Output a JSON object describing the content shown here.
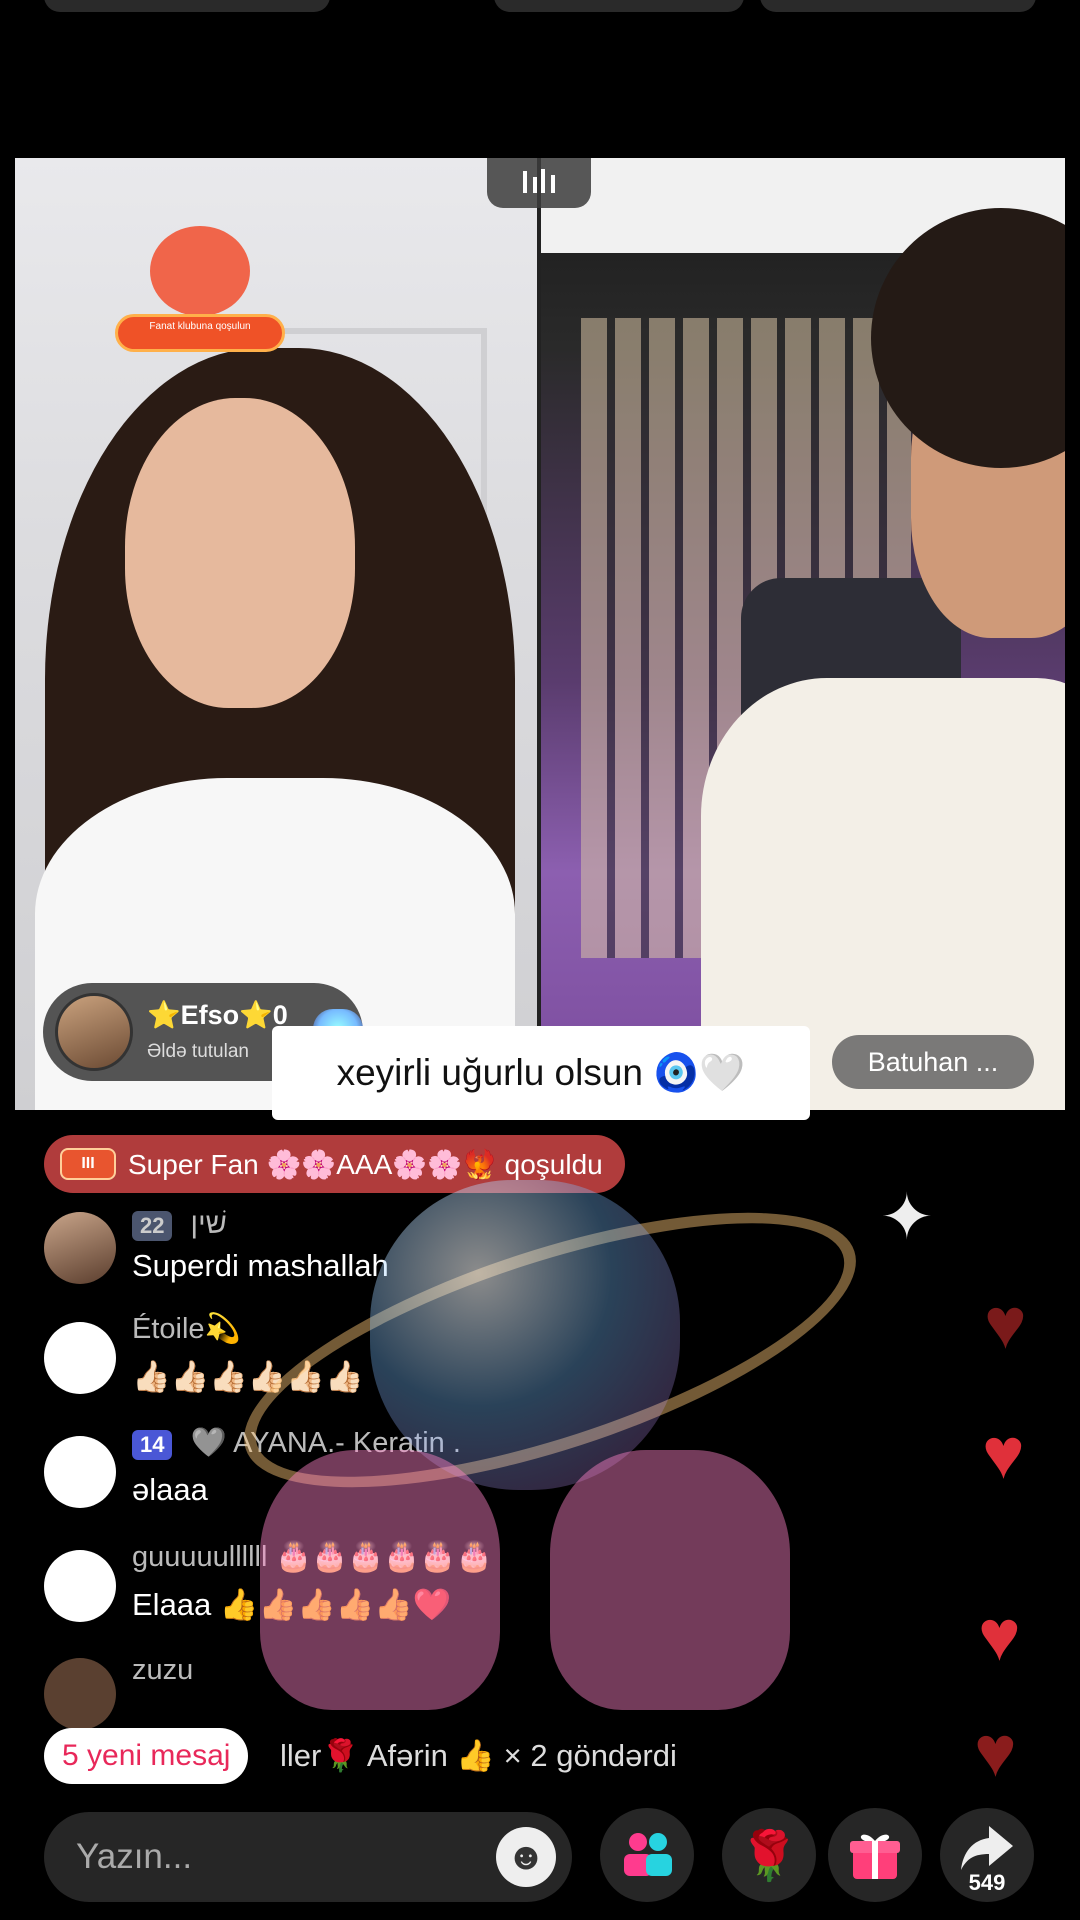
{
  "top_bar": {},
  "video": {
    "split_handle_icon": "split-view-handle-icon",
    "fan_club_label": "Fanat klubuna qoşulun",
    "host": {
      "name": "⭐Efso⭐0",
      "subtitle": "Əldə tutulan"
    },
    "guest": {
      "name": "Batuhan ..."
    },
    "caption": "xeyirli uğurlu olsun 🧿🤍"
  },
  "feed": {
    "joined_banner": {
      "badge": "III",
      "text": "Super Fan 🌸🌸AAA🌸🌸🐦‍🔥 qoşuldu"
    },
    "comments": [
      {
        "level": "22",
        "name": "שׁין",
        "text": "Superdi mashallah"
      },
      {
        "level": "",
        "name": "Étoile💫",
        "text": "👍🏻👍🏻👍🏻👍🏻👍🏻👍🏻"
      },
      {
        "level": "14",
        "name": "🩶 AYANA.- Keratin .",
        "text": "əlaaa"
      },
      {
        "level": "",
        "name": "guuuuullllll 🎂🎂🎂🎂🎂🎂",
        "text": "Elaaa 👍👍👍👍👍❤️"
      },
      {
        "level": "",
        "name": "zuzu",
        "text": ""
      }
    ],
    "gift_line": "ller🌹 Afərin 👍 × 2 göndərdi",
    "new_messages": "5 yeni mesaj"
  },
  "bottom_bar": {
    "input_placeholder": "Yazın...",
    "share_count": "549",
    "icons": {
      "emoji": "smiley-face-icon",
      "guests": "multi-guest-icon",
      "rose": "rose-gift-icon",
      "gift": "gift-box-icon",
      "share": "share-arrow-icon"
    }
  },
  "colors": {
    "banner": "#b03c3c",
    "new_message_text": "#e8285a",
    "heart": "#e0303a",
    "level_badge": "#4a57d6"
  }
}
